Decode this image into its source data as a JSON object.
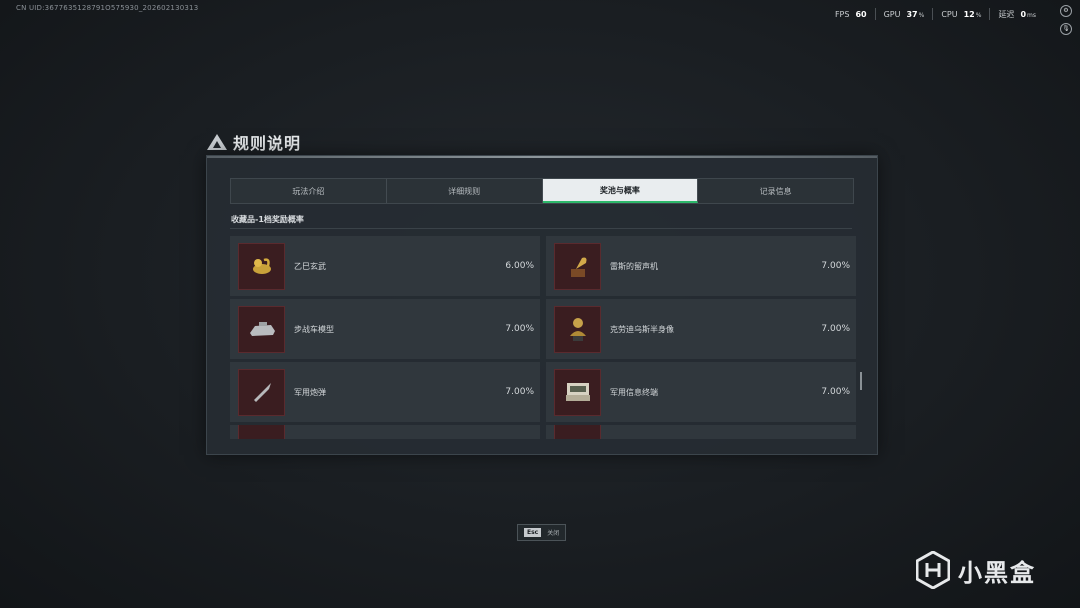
{
  "header": {
    "uid_text": "CN UID:3677635128791O575930_202602130313",
    "fps_label": "FPS",
    "fps_value": "60",
    "gpu_label": "GPU",
    "gpu_value": "37",
    "gpu_unit": "%",
    "cpu_label": "CPU",
    "cpu_value": "12",
    "cpu_unit": "%",
    "latency_label": "延迟",
    "latency_value": "0",
    "latency_unit": "ms"
  },
  "dialog": {
    "title": "规则说明",
    "tabs": [
      {
        "label": "玩法介绍",
        "active": false
      },
      {
        "label": "详细规则",
        "active": false
      },
      {
        "label": "奖池与概率",
        "active": true
      },
      {
        "label": "记录信息",
        "active": false
      }
    ],
    "section_label": "收藏品-1档奖励概率",
    "items": [
      {
        "name": "乙巳玄武",
        "percent": "6.00%",
        "icon": "gold-serpent-figurine-icon"
      },
      {
        "name": "雷斯的留声机",
        "percent": "7.00%",
        "icon": "gramophone-icon"
      },
      {
        "name": "步战车模型",
        "percent": "7.00%",
        "icon": "ifv-model-icon"
      },
      {
        "name": "克劳迪乌斯半身像",
        "percent": "7.00%",
        "icon": "bust-statue-icon"
      },
      {
        "name": "军用炮弹",
        "percent": "7.00%",
        "icon": "artillery-shell-icon"
      },
      {
        "name": "军用信息终端",
        "percent": "7.00%",
        "icon": "military-terminal-icon"
      }
    ]
  },
  "footer": {
    "esc_key": "Esc",
    "esc_label": "关闭"
  },
  "brand": {
    "name": "小黑盒"
  },
  "colors": {
    "accent_green": "#2db86a",
    "card_bg": "#30373d",
    "thumb_bg": "#3a1d20"
  }
}
